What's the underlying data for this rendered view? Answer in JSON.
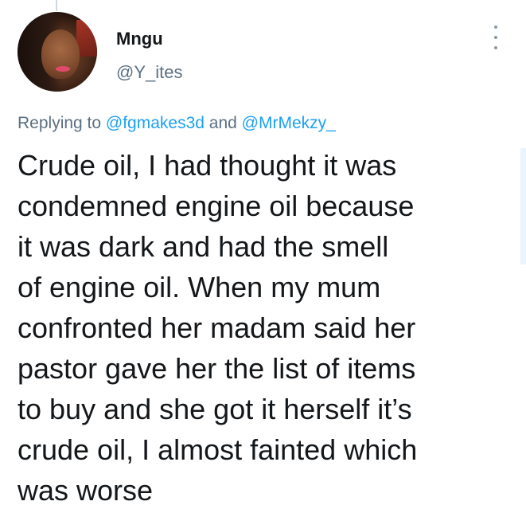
{
  "user": {
    "name": "Mngu",
    "handle": "@Y_ites"
  },
  "reply": {
    "prefix": "Replying to ",
    "mention1": "@fgmakes3d",
    "connector": " and ",
    "mention2": "@MrMekzy_"
  },
  "tweet": {
    "lines": [
      "Crude oil, I had thought it was",
      "condemned engine oil because",
      "it was dark and had the smell",
      "of engine oil. When my mum",
      "confronted her madam said her",
      "pastor gave her the list of items",
      "to buy and she got it herself it’s",
      "crude oil, I almost fainted which",
      "was worse"
    ]
  },
  "icons": {
    "more": "more-vertical-icon",
    "avatar": "profile-photo"
  },
  "colors": {
    "link": "#1da1f2",
    "secondary_text": "#5b7083",
    "primary_text": "#14171a"
  }
}
